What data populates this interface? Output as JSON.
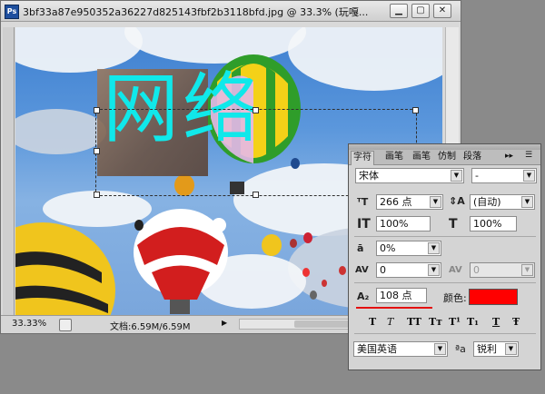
{
  "window": {
    "app_icon": "Ps",
    "title": "3bf33a87e950352a36227d825143fbf2b3118bfd.jpg @ 33.3% (玩嘎...",
    "controls": {
      "minimize": "▁",
      "maximize": "▢",
      "close": "✕"
    }
  },
  "canvas": {
    "text_layer": "网络"
  },
  "status": {
    "zoom": "33.33%",
    "doc_info": "文档:6.59M/6.59M",
    "arrow": "▶"
  },
  "panel": {
    "tabs": [
      "字符",
      "画笔",
      "画笔",
      "仿制",
      "段落"
    ],
    "menu_arrows": "▸▸",
    "menu_icon": "☰",
    "font_family": "宋体",
    "font_style": "-",
    "font_size": "266 点",
    "leading": "(自动)",
    "vertical_scale": "100%",
    "horizontal_scale": "100%",
    "tsume": "0%",
    "kerning": "0",
    "tracking": "0",
    "baseline_shift": "108 点",
    "color_label": "颜色:",
    "color_value": "#ff0000",
    "language": "美国英语",
    "antialias_icon": "ªa",
    "antialias": "锐利",
    "style_buttons": [
      "T",
      "T",
      "TT",
      "Tт",
      "T¹",
      "T₁",
      "T",
      "Ŧ"
    ]
  },
  "colors": {
    "text_cyan": "#10e8ea",
    "swatch_red": "#ff0000",
    "underline_red": "#e41010"
  }
}
